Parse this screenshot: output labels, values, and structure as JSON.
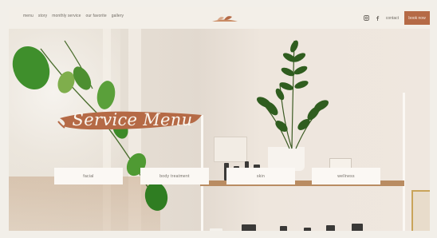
{
  "header": {
    "nav": [
      "menu",
      "story",
      "monthly service",
      "our favorite",
      "gallery"
    ],
    "logo": "leaf-logo",
    "social": [
      "instagram-icon",
      "facebook-icon"
    ],
    "contact_label": "contact",
    "book_label": "book now"
  },
  "hero": {
    "title": "Service Menu",
    "services": [
      "facial",
      "body treatment",
      "skin",
      "wellness"
    ]
  },
  "colors": {
    "accent": "#b56a46",
    "header_bg": "#f3efe8",
    "button_bg": "#fbf8f4",
    "brush": "#b56a46"
  }
}
